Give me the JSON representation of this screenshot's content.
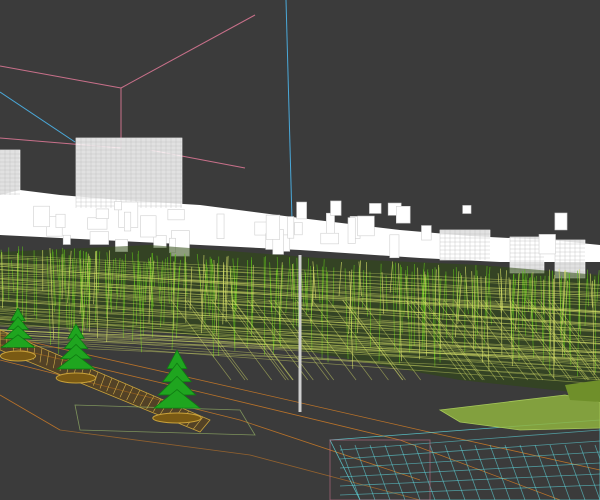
{
  "viewport": {
    "background": "#3b3b3b",
    "wireframe_colors": {
      "buildings": "#ffffff",
      "vegetation": "#5fbf1a",
      "vegetation_light": "#d9e36a",
      "trees": "#1fa51f",
      "roads": "#b8722a",
      "helper_pink": "#c8708a",
      "helper_blue": "#4aa8d8",
      "water_cyan": "#5fd9e0",
      "ground_lime": "#8fb340",
      "pole": "#cfcfcf"
    },
    "trees_count": 3
  }
}
